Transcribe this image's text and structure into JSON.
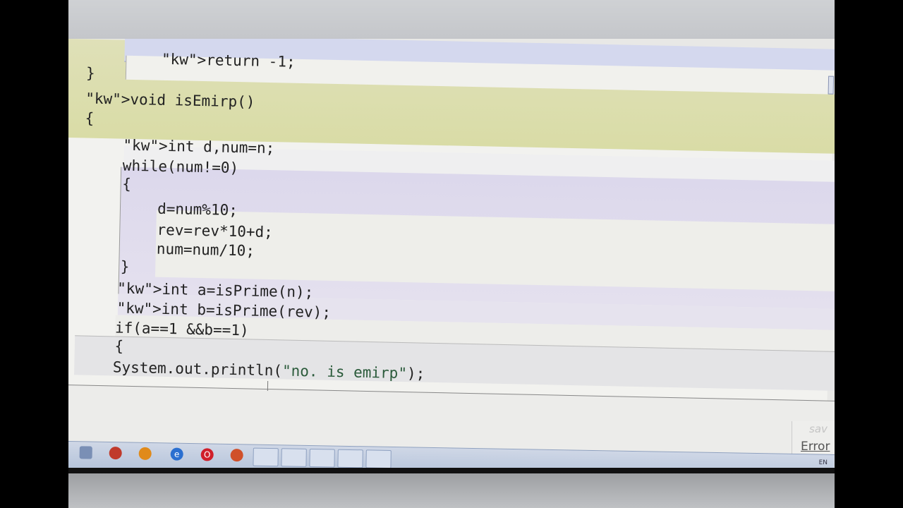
{
  "editor": {
    "lines": [
      {
        "text": "    return -1;",
        "indent": 1
      },
      {
        "text": "}",
        "indent": 0
      },
      {
        "text": "void isEmirp()",
        "indent": 0
      },
      {
        "text": "{",
        "indent": 0
      },
      {
        "text": "    int d,num=n;",
        "indent": 1
      },
      {
        "text": "    while(num!=0)",
        "indent": 1
      },
      {
        "text": "    {",
        "indent": 1
      },
      {
        "text": "        d=num%10;",
        "indent": 2
      },
      {
        "text": "        rev=rev*10+d;",
        "indent": 2
      },
      {
        "text": "        num=num/10;",
        "indent": 2
      },
      {
        "text": "    }",
        "indent": 1
      },
      {
        "text": "    int a=isPrime(n);",
        "indent": 1
      },
      {
        "text": "    int b=isPrime(rev);",
        "indent": 1
      },
      {
        "text": "    if(a==1 &&b==1)",
        "indent": 1
      },
      {
        "text": "    {",
        "indent": 1
      },
      {
        "text": "    System.out.println(\"no. is emirp\");",
        "indent": 1
      }
    ]
  },
  "status": {
    "saved_label": "sav",
    "error_label": "Error"
  },
  "tray": {
    "language": "EN"
  },
  "taskbar": {
    "icons": [
      "start-icon",
      "chrome-icon",
      "media-player-icon",
      "ie-icon",
      "opera-icon",
      "chrome-alt-icon",
      "calculator-icon",
      "word-icon",
      "notepad-icon",
      "browser-icon",
      "bluej-icon"
    ]
  }
}
